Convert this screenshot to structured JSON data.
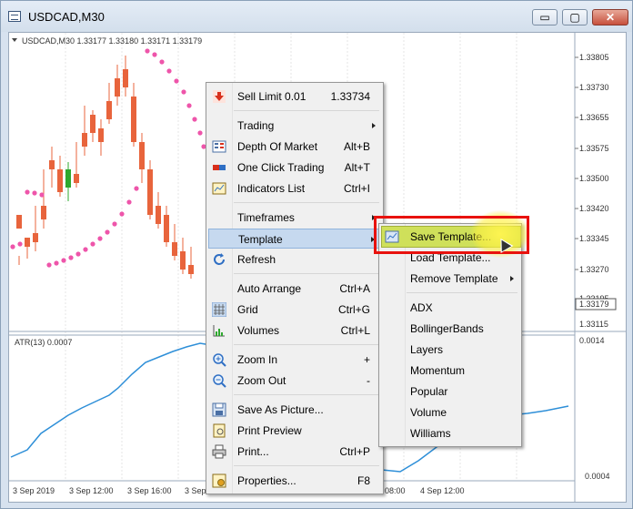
{
  "window": {
    "title": "USDCAD,M30",
    "minimize": "▭",
    "restore": "▢",
    "close": "✕"
  },
  "chart": {
    "header": "USDCAD,M30  1.33177 1.33180 1.33171 1.33179",
    "price_labels": [
      "1.33805",
      "1.33730",
      "1.33655",
      "1.33575",
      "1.33500",
      "1.33420",
      "1.33345",
      "1.33270",
      "1.33195"
    ],
    "current_price": "1.33179",
    "last_price": "1.33115",
    "atr_header": "ATR(13) 0.0007",
    "atr_labels": [
      "0.0014",
      "0.0004"
    ],
    "time_labels": [
      "3 Sep 2019",
      "3 Sep 12:00",
      "3 Sep 16:00",
      "3 Sep",
      "08:00",
      "4 Sep 12:00"
    ],
    "colors": {
      "bull": "#2ea82e",
      "bear": "#e8643c",
      "sar": "#ee55aa",
      "atr": "#2e8fd8"
    }
  },
  "context_menu": {
    "items": [
      {
        "label": "Sell Limit 0.01",
        "shortcut": "1.33734",
        "icon": "sell-arrow-icon"
      },
      {
        "label": "Trading",
        "submenu": true
      },
      {
        "label": "Depth Of Market",
        "shortcut": "Alt+B",
        "icon": "depth-of-market-icon"
      },
      {
        "label": "One Click Trading",
        "shortcut": "Alt+T",
        "icon": "one-click-trading-icon"
      },
      {
        "label": "Indicators List",
        "shortcut": "Ctrl+I",
        "icon": "indicators-list-icon"
      },
      {
        "label": "Timeframes",
        "submenu": true
      },
      {
        "label": "Template",
        "submenu": true,
        "highlighted": true
      },
      {
        "label": "Refresh",
        "icon": "refresh-icon"
      },
      {
        "label": "Auto Arrange",
        "shortcut": "Ctrl+A"
      },
      {
        "label": "Grid",
        "shortcut": "Ctrl+G",
        "icon": "grid-icon"
      },
      {
        "label": "Volumes",
        "shortcut": "Ctrl+L",
        "icon": "volumes-icon"
      },
      {
        "label": "Zoom In",
        "shortcut": "+",
        "icon": "zoom-in-icon"
      },
      {
        "label": "Zoom Out",
        "shortcut": "-",
        "icon": "zoom-out-icon"
      },
      {
        "label": "Save As Picture...",
        "icon": "save-picture-icon"
      },
      {
        "label": "Print Preview",
        "icon": "print-preview-icon"
      },
      {
        "label": "Print...",
        "shortcut": "Ctrl+P",
        "icon": "printer-icon"
      },
      {
        "label": "Properties...",
        "shortcut": "F8",
        "icon": "properties-icon"
      }
    ]
  },
  "template_submenu": {
    "items": [
      {
        "label": "Save Template...",
        "icon": "save-template-icon",
        "highlighted": true
      },
      {
        "label": "Load Template..."
      },
      {
        "label": "Remove Template",
        "submenu": true
      },
      {
        "label": "ADX"
      },
      {
        "label": "BollingerBands"
      },
      {
        "label": "Layers"
      },
      {
        "label": "Momentum"
      },
      {
        "label": "Popular"
      },
      {
        "label": "Volume"
      },
      {
        "label": "Williams"
      }
    ]
  }
}
